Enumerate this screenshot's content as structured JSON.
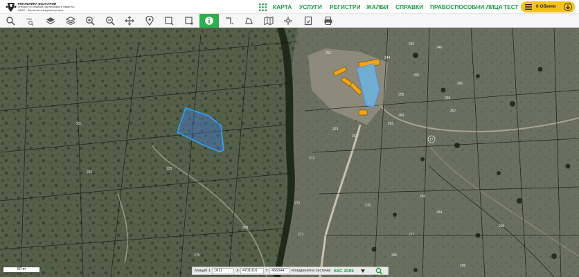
{
  "header": {
    "logo_line1": "РЕПУБЛИКА БЪЛГАРИЯ",
    "logo_line2": "Агенция по геодезия, картография и кадастър",
    "logo_line3": "КАИС - Портал за електронни услуги",
    "nav": [
      "КАРТА",
      "УСЛУГИ",
      "РЕГИСТРИ",
      "ЖАЛБИ",
      "СПРАВКИ",
      "ПРАВОСПОСОБНИ ЛИЦА",
      "ТЕСТ"
    ],
    "objects_label": "0 Обекти"
  },
  "toolbar": {
    "tools": [
      "search-icon",
      "zoom-to-extent-icon",
      "layers-icon",
      "base-layers-icon",
      "zoom-in-icon",
      "zoom-out-icon",
      "pan-icon",
      "place-marker-icon",
      "select-rectangle-icon",
      "select-polygon-icon",
      "info-icon",
      "measure-distance-icon",
      "measure-area-icon",
      "map-compare-icon",
      "crosshair-icon",
      "export-icon",
      "print-icon"
    ],
    "active_tool": "info-icon",
    "accent_color": "#2fb04f"
  },
  "map": {
    "parcel_labels": [
      "245",
      "246",
      "244",
      "251",
      "266",
      "260",
      "258",
      "265",
      "257",
      "264",
      "263",
      "262",
      "261",
      "17",
      "251",
      "231",
      "225",
      "272",
      "272",
      "273",
      "276",
      "283",
      "284",
      "290",
      "277",
      "286",
      "285",
      "271",
      "208",
      "275"
    ],
    "selected_parcel_color": "#3b82f6",
    "building_color": "#f2a516"
  },
  "scalebar": {
    "label": "50 m"
  },
  "coordbar": {
    "scale_label": "Мащаб 1:",
    "scale_value": "1611",
    "x_label": "X:",
    "x_value": "4701016",
    "y_label": "Y:",
    "y_value": "456044",
    "system_label": "Координатна система:",
    "system_value": "ККС 2005"
  }
}
